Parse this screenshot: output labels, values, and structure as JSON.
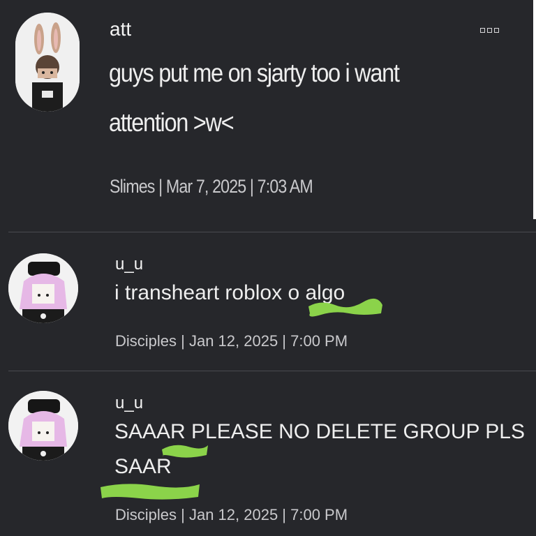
{
  "posts": [
    {
      "username": "att",
      "message_lines": [
        "guys put me on sjarty too i want",
        "attention >w<"
      ],
      "meta": "Slimes | Mar 7, 2025 | 7:03 AM"
    },
    {
      "username": "u_u",
      "message_lines": [
        "i transheart roblox o algo"
      ],
      "meta": "Disciples | Jan 12, 2025 | 7:00 PM"
    },
    {
      "username": "u_u",
      "message_lines": [
        "SAAAR PLEASE NO DELETE GROUP PLS",
        "SAAR"
      ],
      "meta": "Disciples | Jan 12, 2025 | 7:00 PM"
    }
  ],
  "icons": {
    "more": "more-options-icon",
    "avatar1": "bunny-ears-avatar",
    "avatar2": "pink-hair-beanie-avatar"
  },
  "colors": {
    "background": "#26272b",
    "text": "#eeeeee",
    "meta": "#c9c9cc",
    "divider": "#4a4b50",
    "scribble": "#8bd34a"
  }
}
